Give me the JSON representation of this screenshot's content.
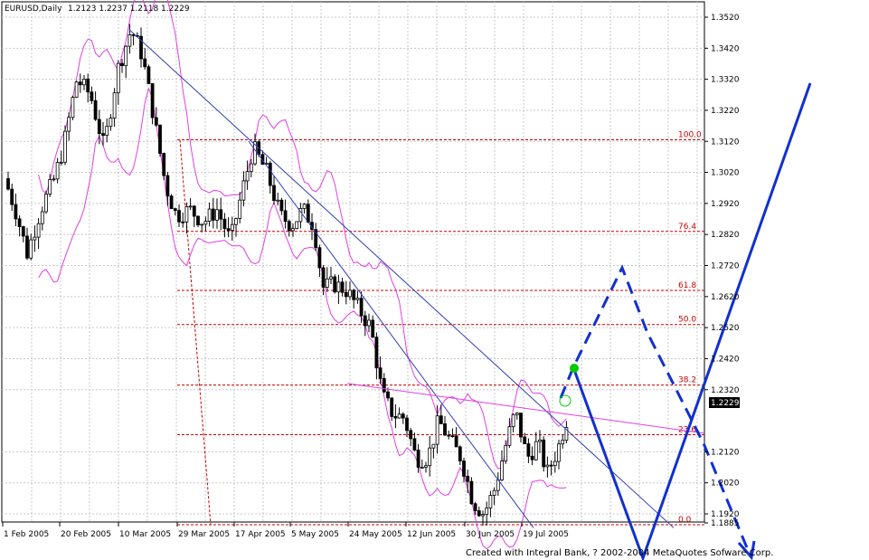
{
  "header": {
    "symbol": "EURUSD,Daily",
    "ohlc": "1.2123 1.2237 1.2118 1.2229"
  },
  "footer": {
    "credit": "Created with Integral Bank, ? 2002-2004 MetaQuotes Sofware Corp."
  },
  "colors": {
    "grid": "#c8c8c8",
    "candle": "#000000",
    "bollinger": "#e040e0",
    "trendline": "#3040b0",
    "fibonacci": "#cc0000",
    "forecast": "#1030d0",
    "marker": "#00cc00",
    "price_tag_bg": "#000000"
  },
  "chart_data": {
    "type": "candlestick",
    "symbol": "EURUSD",
    "timeframe": "Daily",
    "last_ohlc": {
      "open": 1.2123,
      "high": 1.2237,
      "low": 1.2118,
      "close": 1.2229
    },
    "current_price": "1.2229",
    "x_tick_labels": [
      "1 Feb 2005",
      "20 Feb 2005",
      "10 Mar 2005",
      "29 Mar 2005",
      "17 Apr 2005",
      "5 May 2005",
      "24 May 2005",
      "12 Jun 2005",
      "30 Jun 2005",
      "19 Jul 2005"
    ],
    "y_tick_labels": [
      "1.3520",
      "1.3420",
      "1.3320",
      "1.3220",
      "1.3120",
      "1.3020",
      "1.2920",
      "1.2820",
      "1.2720",
      "1.2620",
      "1.2520",
      "1.2420",
      "1.2320",
      "1.2120",
      "1.2020",
      "1.1920",
      "1.1885"
    ],
    "ylim": [
      1.1875,
      1.357
    ],
    "fibonacci_levels": [
      {
        "label": "100.0",
        "price": 1.3125
      },
      {
        "label": "76.4",
        "price": 1.283
      },
      {
        "label": "61.8",
        "price": 1.264
      },
      {
        "label": "50.0",
        "price": 1.253
      },
      {
        "label": "38.2",
        "price": 1.2335
      },
      {
        "label": "23.6",
        "price": 1.2175
      },
      {
        "label": "0.0",
        "price": 1.1885
      }
    ],
    "price_path": [
      [
        0,
        1.3
      ],
      [
        12,
        1.29
      ],
      [
        25,
        1.276
      ],
      [
        40,
        1.29
      ],
      [
        55,
        1.3
      ],
      [
        65,
        1.31
      ],
      [
        80,
        1.332
      ],
      [
        95,
        1.327
      ],
      [
        110,
        1.31
      ],
      [
        125,
        1.335
      ],
      [
        140,
        1.348
      ],
      [
        152,
        1.34
      ],
      [
        165,
        1.32
      ],
      [
        178,
        1.298
      ],
      [
        190,
        1.288
      ],
      [
        205,
        1.29
      ],
      [
        220,
        1.286
      ],
      [
        235,
        1.29
      ],
      [
        250,
        1.28
      ],
      [
        262,
        1.295
      ],
      [
        275,
        1.31
      ],
      [
        290,
        1.302
      ],
      [
        305,
        1.288
      ],
      [
        318,
        1.285
      ],
      [
        330,
        1.29
      ],
      [
        342,
        1.285
      ],
      [
        352,
        1.265
      ],
      [
        365,
        1.266
      ],
      [
        378,
        1.264
      ],
      [
        392,
        1.258
      ],
      [
        405,
        1.252
      ],
      [
        418,
        1.23
      ],
      [
        430,
        1.224
      ],
      [
        442,
        1.223
      ],
      [
        455,
        1.21
      ],
      [
        468,
        1.21
      ],
      [
        480,
        1.222
      ],
      [
        492,
        1.216
      ],
      [
        505,
        1.21
      ],
      [
        518,
        1.196
      ],
      [
        530,
        1.192
      ],
      [
        542,
        1.2
      ],
      [
        555,
        1.215
      ],
      [
        565,
        1.225
      ],
      [
        578,
        1.21
      ],
      [
        590,
        1.215
      ],
      [
        600,
        1.205
      ],
      [
        612,
        1.213
      ],
      [
        622,
        1.2229
      ]
    ]
  }
}
